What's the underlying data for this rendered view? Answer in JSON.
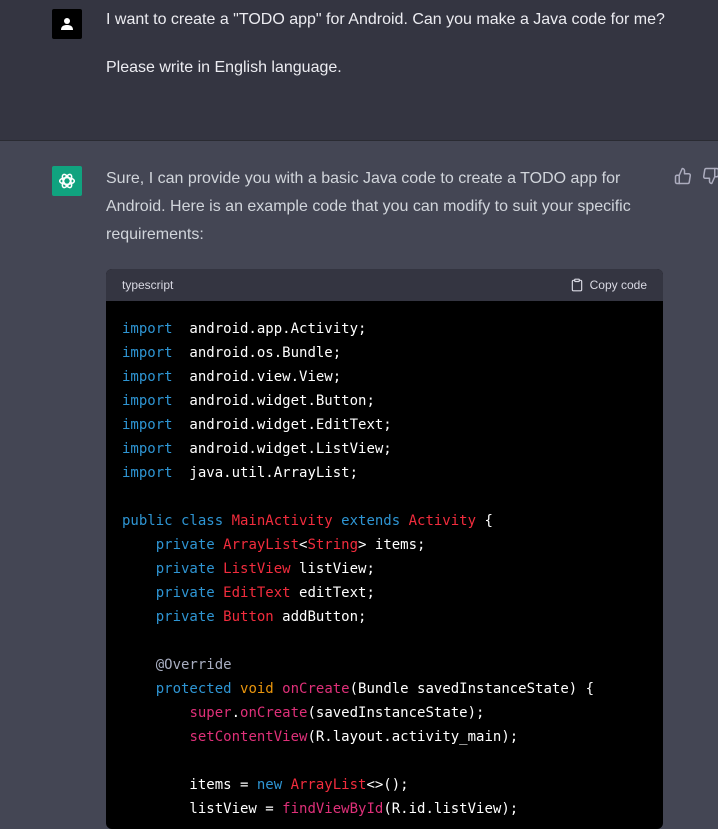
{
  "user_message": {
    "paragraphs": [
      "I want to create a \"TODO app\" for Android. Can you make a Java code for me?",
      "Please write in English language."
    ]
  },
  "assistant_message": {
    "intro": "Sure, I can provide you with a basic Java code to create a TODO app for Android. Here is an example code that you can modify to suit your specific requirements:"
  },
  "code_block": {
    "language": "typescript",
    "copy_label": "Copy code",
    "lines": [
      [
        [
          "k",
          "import"
        ],
        [
          "",
          "  android.app.Activity;"
        ]
      ],
      [
        [
          "k",
          "import"
        ],
        [
          "",
          "  android.os.Bundle;"
        ]
      ],
      [
        [
          "k",
          "import"
        ],
        [
          "",
          "  android.view.View;"
        ]
      ],
      [
        [
          "k",
          "import"
        ],
        [
          "",
          "  android.widget.Button;"
        ]
      ],
      [
        [
          "k",
          "import"
        ],
        [
          "",
          "  android.widget.EditText;"
        ]
      ],
      [
        [
          "k",
          "import"
        ],
        [
          "",
          "  android.widget.ListView;"
        ]
      ],
      [
        [
          "k",
          "import"
        ],
        [
          "",
          "  java.util.ArrayList;"
        ]
      ],
      [],
      [
        [
          "k",
          "public class "
        ],
        [
          "t",
          "MainActivity"
        ],
        [
          "k",
          " extends "
        ],
        [
          "t",
          "Activity"
        ],
        [
          "",
          " {"
        ]
      ],
      [
        [
          "",
          "    "
        ],
        [
          "k",
          "private "
        ],
        [
          "t",
          "ArrayList"
        ],
        [
          "",
          "<"
        ],
        [
          "t",
          "String"
        ],
        [
          "",
          "> items;"
        ]
      ],
      [
        [
          "",
          "    "
        ],
        [
          "k",
          "private "
        ],
        [
          "t",
          "ListView"
        ],
        [
          "",
          " listView;"
        ]
      ],
      [
        [
          "",
          "    "
        ],
        [
          "k",
          "private "
        ],
        [
          "t",
          "EditText"
        ],
        [
          "",
          " editText;"
        ]
      ],
      [
        [
          "",
          "    "
        ],
        [
          "k",
          "private "
        ],
        [
          "t",
          "Button"
        ],
        [
          "",
          " addButton;"
        ]
      ],
      [],
      [
        [
          "",
          "    "
        ],
        [
          "a",
          "@Override"
        ]
      ],
      [
        [
          "",
          "    "
        ],
        [
          "k",
          "protected "
        ],
        [
          "o",
          "void "
        ],
        [
          "f",
          "onCreate"
        ],
        [
          "",
          "(Bundle savedInstanceState) {"
        ]
      ],
      [
        [
          "",
          "        "
        ],
        [
          "f",
          "super"
        ],
        [
          "",
          "."
        ],
        [
          "f",
          "onCreate"
        ],
        [
          "",
          "(savedInstanceState);"
        ]
      ],
      [
        [
          "",
          "        "
        ],
        [
          "f",
          "setContentView"
        ],
        [
          "",
          "(R.layout.activity_main);"
        ]
      ],
      [],
      [
        [
          "",
          "        items = "
        ],
        [
          "k",
          "new "
        ],
        [
          "t",
          "ArrayList"
        ],
        [
          "",
          "<>();"
        ]
      ],
      [
        [
          "",
          "        listView = "
        ],
        [
          "f",
          "findViewById"
        ],
        [
          "",
          "(R.id.listView);"
        ]
      ]
    ]
  },
  "colors": {
    "keyword": "#2e95d3",
    "type": "#f22c3d",
    "function": "#df3079",
    "void": "#e9950c",
    "annotation": "#a9aec1",
    "brand": "#10a37f"
  },
  "icons": {
    "user_avatar": "user-icon",
    "assistant_avatar": "openai-logo-icon",
    "copy": "clipboard-icon",
    "thumbs_up": "thumbs-up-icon",
    "thumbs_down": "thumbs-down-icon"
  }
}
